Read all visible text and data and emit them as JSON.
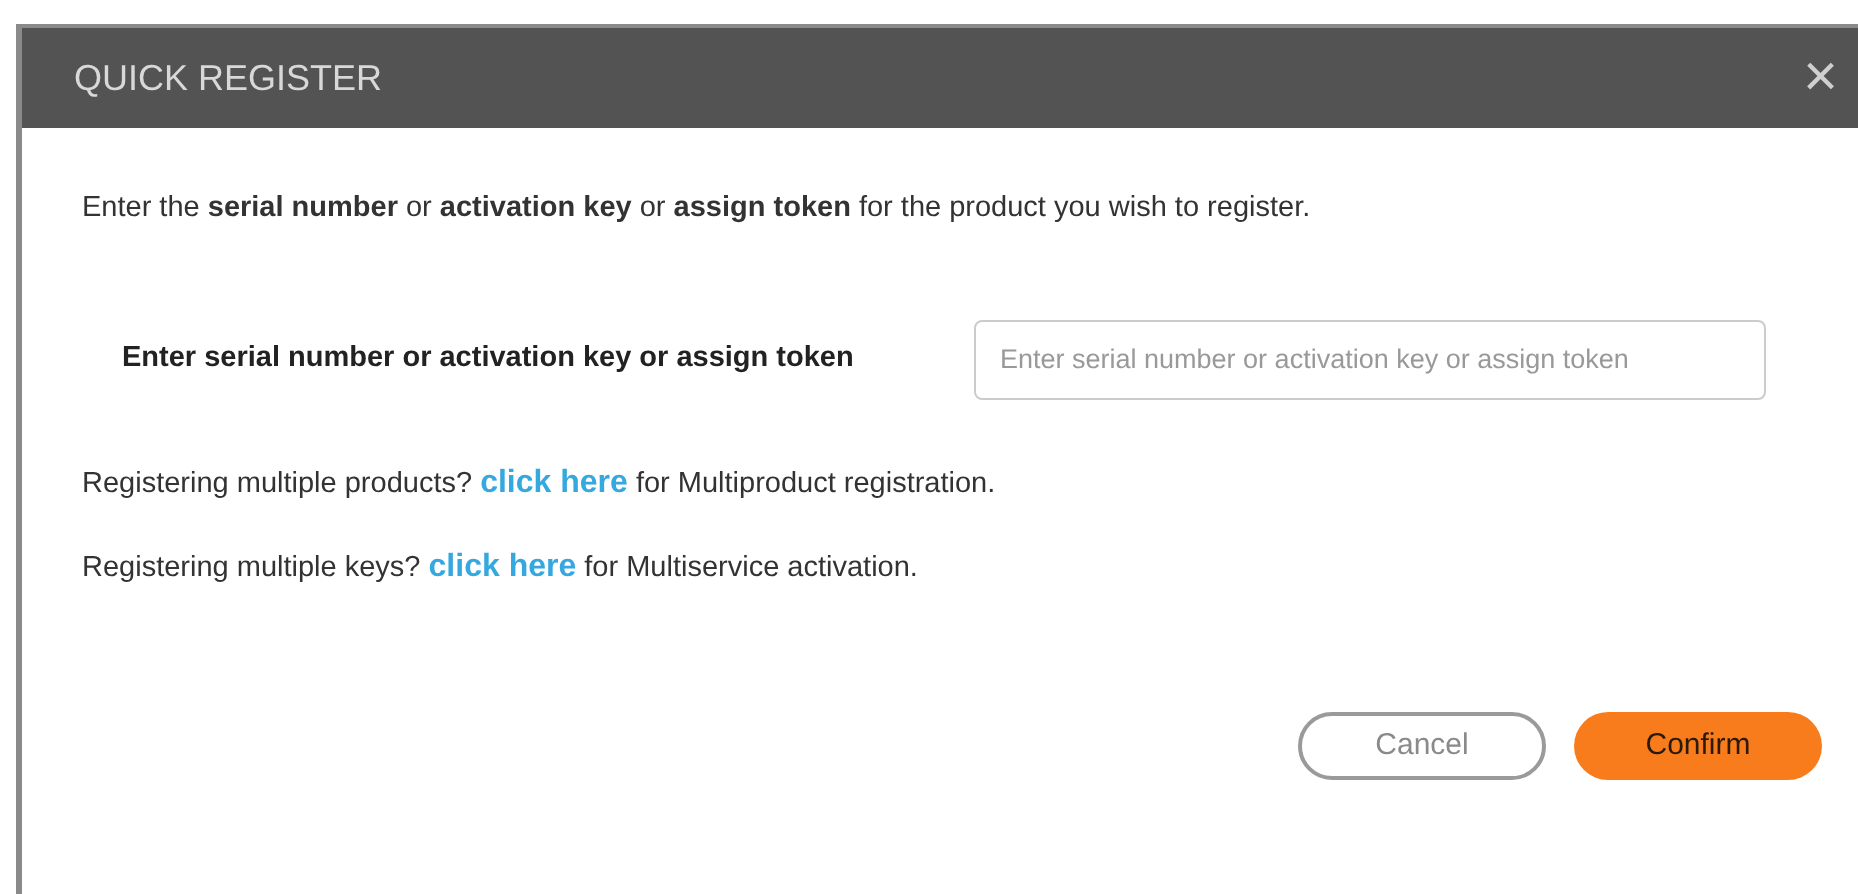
{
  "dialog": {
    "title": "QUICK REGISTER",
    "close": "×"
  },
  "intro": "Enter the **serial number** or **activation key** or **assign token** for the product you wish to register.",
  "field": {
    "label": "Enter serial number or activation key or assign token",
    "placeholder": "Enter serial number or activation key or assign token"
  },
  "links": [
    {
      "before": "Registering multiple products?",
      "link": "click here",
      "after": "for Multiproduct registration."
    },
    {
      "before": "Registering multiple keys?",
      "link": "click here",
      "after": "for Multiservice activation."
    }
  ],
  "buttons": [
    {
      "label": "Cancel",
      "kind": "secondary"
    },
    {
      "label": "Confirm",
      "kind": "primary"
    }
  ]
}
